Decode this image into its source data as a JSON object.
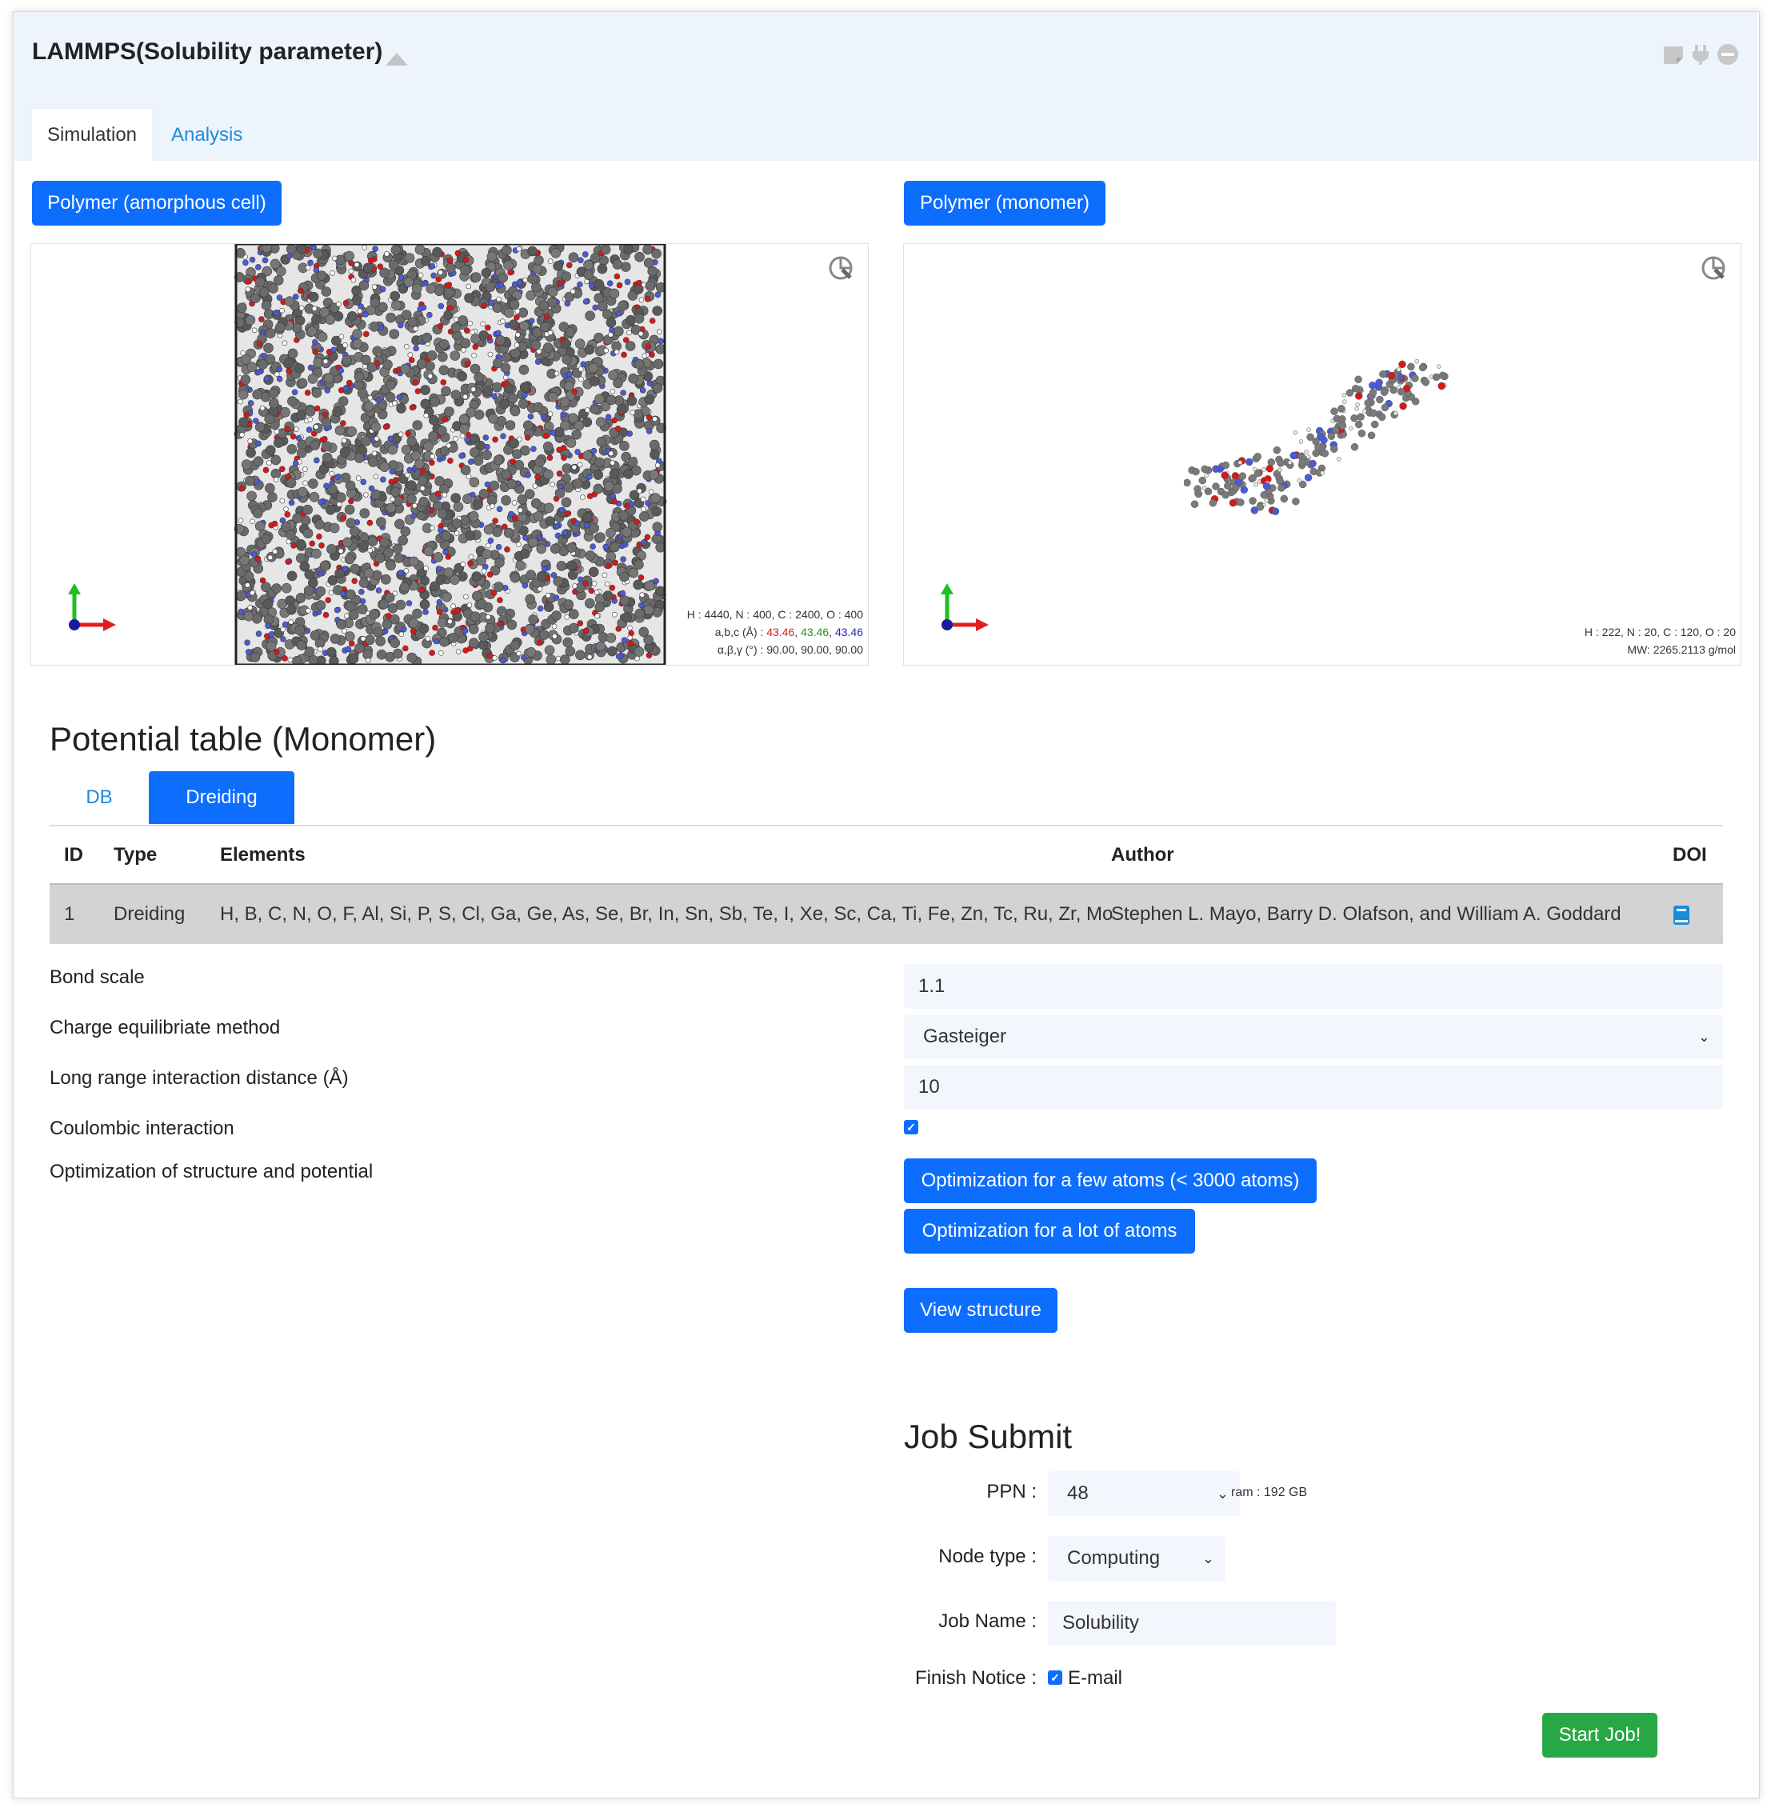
{
  "app": {
    "title": "LAMMPS(Solubility parameter)"
  },
  "tabs": [
    "Simulation",
    "Analysis"
  ],
  "left_viewer": {
    "button": "Polymer (amorphous cell)",
    "composition": "H : 4440, N : 400, C : 2400, O : 400",
    "abc_label": "a,b,c (Å) :",
    "a": "43.46",
    "b": "43.46",
    "c": "43.46",
    "angles": "α,β,γ (°) : 90.00, 90.00, 90.00"
  },
  "right_viewer": {
    "button": "Polymer (monomer)",
    "composition": "H : 222, N : 20, C : 120, O : 20",
    "mw": "MW: 2265.2113 g/mol"
  },
  "potential": {
    "heading": "Potential table (Monomer)",
    "subtabs": [
      "DB",
      "Dreiding"
    ],
    "columns": [
      "ID",
      "Type",
      "Elements",
      "Author",
      "DOI"
    ],
    "rows": [
      {
        "id": "1",
        "type": "Dreiding",
        "elements": "H, B, C, N, O, F, Al, Si, P, S, Cl, Ga, Ge, As, Se, Br, In, Sn, Sb, Te, I, Xe, Sc, Ca, Ti, Fe, Zn, Tc, Ru, Zr, Mo",
        "author": "Stephen L. Mayo, Barry D. Olafson, and William A. Goddard"
      }
    ]
  },
  "settings": {
    "bond_scale_label": "Bond scale",
    "bond_scale": "1.1",
    "charge_label": "Charge equilibriate method",
    "charge_value": "Gasteiger",
    "long_range_label": "Long range interaction distance (Å)",
    "long_range": "10",
    "coulombic_label": "Coulombic interaction",
    "coulombic_checked": true,
    "optimization_label": "Optimization of structure and potential",
    "opt_few_button": "Optimization for a few atoms (< 3000 atoms)",
    "opt_lot_button": "Optimization for a lot of atoms",
    "view_structure_button": "View structure"
  },
  "job": {
    "heading": "Job Submit",
    "ppn_label": "PPN :",
    "ppn_value": "48",
    "ram": "ram : 192 GB",
    "node_type_label": "Node type :",
    "node_type_value": "Computing",
    "job_name_label": "Job Name :",
    "job_name_value": "Solubility",
    "finish_label": "Finish Notice :",
    "finish_option": "E-mail",
    "start_button": "Start Job!"
  },
  "colors": {
    "primary": "#0d6efd",
    "success": "#28a745",
    "header_bg": "#eef4fb",
    "a_color": "#d62020",
    "b_color": "#1a9a1a",
    "c_color": "#2a2ab8"
  }
}
